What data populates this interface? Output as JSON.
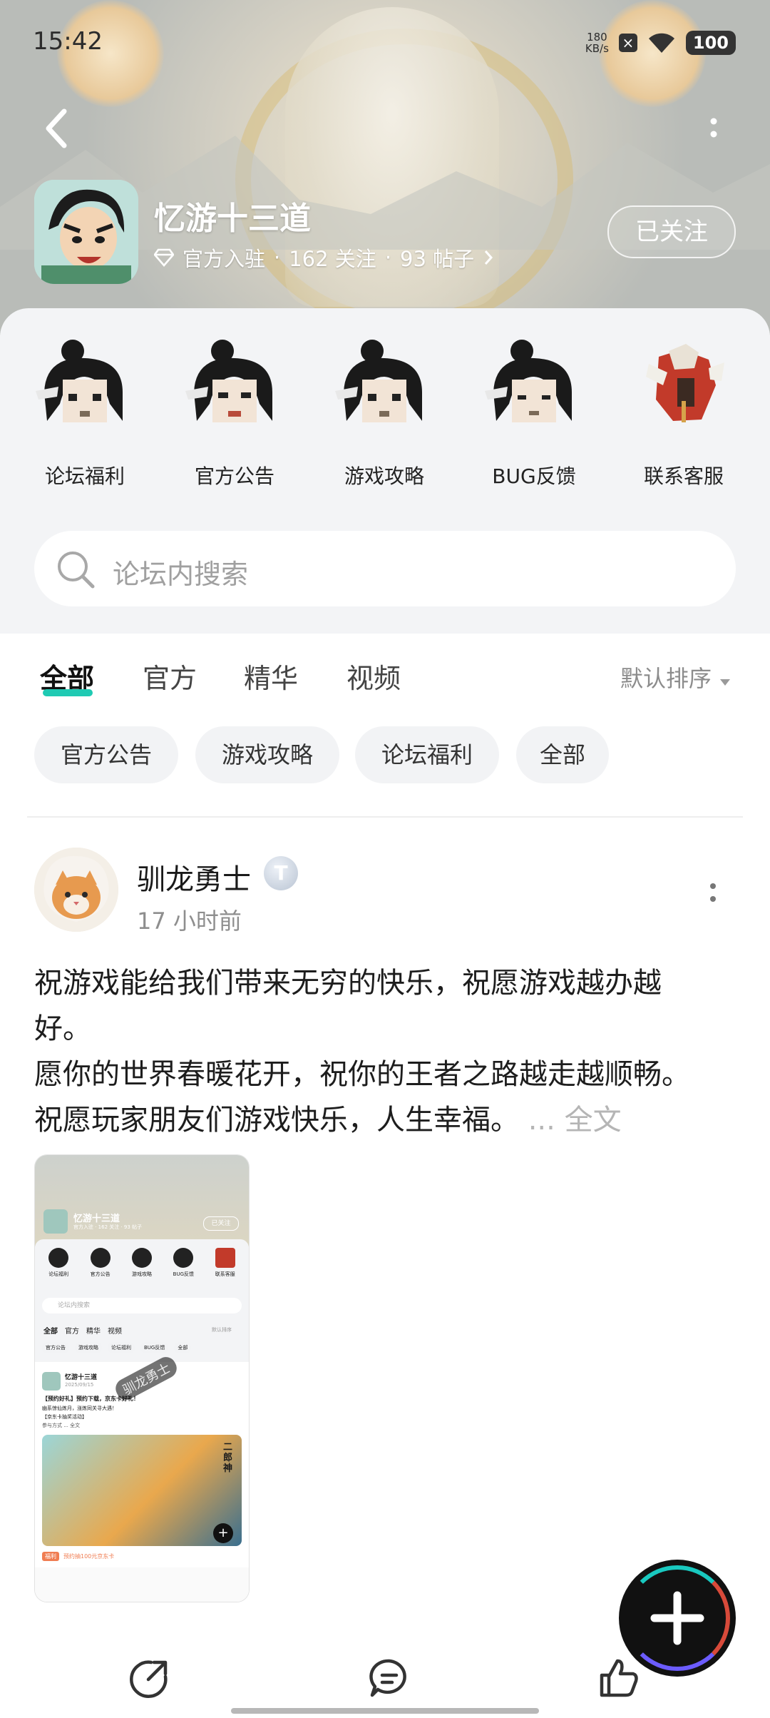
{
  "status_bar": {
    "time": "15:42",
    "net_speed_value": "180",
    "net_speed_unit": "KB/s",
    "notif": "×",
    "battery": "100"
  },
  "header": {
    "forum_title": "忆游十三道",
    "official": "官方入驻",
    "followers": "162 关注",
    "posts": "93 帖子",
    "sep": "·",
    "follow_button": "已关注"
  },
  "channels": [
    {
      "label": "论坛福利"
    },
    {
      "label": "官方公告"
    },
    {
      "label": "游戏攻略"
    },
    {
      "label": "BUG反馈"
    },
    {
      "label": "联系客服"
    }
  ],
  "search": {
    "placeholder": "论坛内搜索"
  },
  "tabs": [
    {
      "label": "全部"
    },
    {
      "label": "官方"
    },
    {
      "label": "精华"
    },
    {
      "label": "视频"
    }
  ],
  "sort": {
    "label": "默认排序"
  },
  "chips": [
    {
      "label": "官方公告"
    },
    {
      "label": "游戏攻略"
    },
    {
      "label": "论坛福利"
    },
    {
      "label": "全部"
    }
  ],
  "post": {
    "username": "驯龙勇士",
    "badge": "T",
    "time": "17 小时前",
    "lines": [
      "祝游戏能给我们带来无穷的快乐，祝愿游戏越办越",
      "好。",
      "愿你的世界春暖花开，祝你的王者之路越走越顺畅。",
      "祝愿玩家朋友们游戏快乐，人生幸福。"
    ],
    "ellipsis": "... 全文"
  },
  "thumb": {
    "title": "忆游十三道",
    "meta": "官方入驻 · 162 关注 · 93 帖子",
    "follow": "已关注",
    "channels": [
      "论坛福利",
      "官方公告",
      "游戏攻略",
      "BUG反馈",
      "联系客服"
    ],
    "search": "论坛内搜索",
    "tabs": [
      "全部",
      "官方",
      "精华",
      "视频"
    ],
    "sort": "默认排序",
    "chips": [
      "官方公告",
      "游戏攻略",
      "论坛福利",
      "BUG反馈",
      "全部"
    ],
    "post_author": "忆游十三道",
    "post_date": "2025/09/15",
    "post_title": "【预约好礼】预约下载，京东卡好礼！",
    "post_line1": "幽系惊仙炼月，涨炼同关寻大遇！",
    "post_line2": "【京东卡抽奖活动】",
    "post_line3": "参与方式 ... 全文",
    "watermark": "驯龙勇士",
    "banner_text": "二郎神",
    "promo_tag": "福利",
    "promo": "预约抽100元京东卡"
  }
}
